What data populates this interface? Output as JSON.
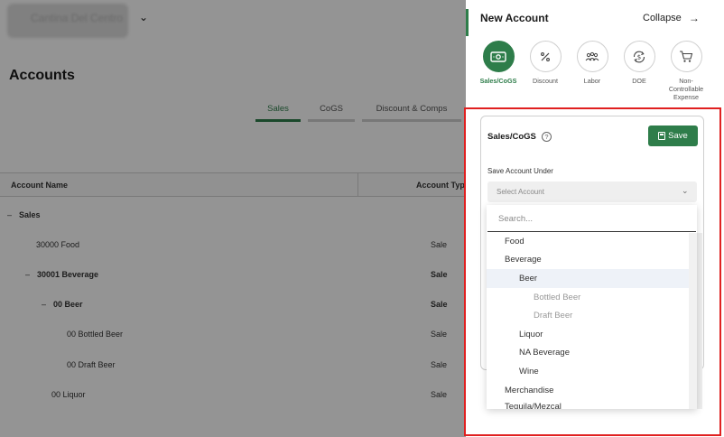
{
  "header": {
    "restaurant_name": "Cantina Del Centro"
  },
  "page": {
    "title": "Accounts"
  },
  "tabs": [
    {
      "label": "Sales",
      "active": true
    },
    {
      "label": "CoGS",
      "active": false
    },
    {
      "label": "Discount & Comps",
      "active": false
    }
  ],
  "table": {
    "columns": [
      "Account Name",
      "Account Type"
    ],
    "rows": [
      {
        "name": "Sales",
        "type": "",
        "bold": true,
        "prefix": "–"
      },
      {
        "name": "30000 Food",
        "type": "Sale",
        "bold": false,
        "prefix": ""
      },
      {
        "name": "30001 Beverage",
        "type": "Sale",
        "bold": true,
        "prefix": "–"
      },
      {
        "name": "00 Beer",
        "type": "Sale",
        "bold": true,
        "prefix": "–"
      },
      {
        "name": "00 Bottled Beer",
        "type": "Sale",
        "bold": false,
        "prefix": ""
      },
      {
        "name": "00 Draft Beer",
        "type": "Sale",
        "bold": false,
        "prefix": ""
      },
      {
        "name": "00 Liquor",
        "type": "Sale",
        "bold": false,
        "prefix": ""
      }
    ]
  },
  "panel": {
    "title": "New Account",
    "collapse_label": "Collapse",
    "account_types": [
      {
        "label": "Sales/CoGS",
        "icon": "cash-icon",
        "active": true
      },
      {
        "label": "Discount",
        "icon": "percent-icon",
        "active": false
      },
      {
        "label": "Labor",
        "icon": "labor-icon",
        "active": false
      },
      {
        "label": "DOE",
        "icon": "dollar-cycle-icon",
        "active": false
      },
      {
        "label": "Non-Controllable Expense",
        "icon": "cart-icon",
        "active": false
      }
    ],
    "form": {
      "title": "Sales/CoGS",
      "help_glyph": "?",
      "save_label": "Save",
      "field_label": "Save Account Under",
      "select_placeholder": "Select Account",
      "search_placeholder": "Search..."
    },
    "dropdown_items": [
      {
        "label": "Food",
        "level": 0,
        "selected": false
      },
      {
        "label": "Beverage",
        "level": 0,
        "selected": false
      },
      {
        "label": "Beer",
        "level": 1,
        "selected": true
      },
      {
        "label": "Bottled Beer",
        "level": 2,
        "selected": false
      },
      {
        "label": "Draft Beer",
        "level": 2,
        "selected": false
      },
      {
        "label": "Liquor",
        "level": 1,
        "selected": false
      },
      {
        "label": "NA Beverage",
        "level": 1,
        "selected": false
      },
      {
        "label": "Wine",
        "level": 1,
        "selected": false
      },
      {
        "label": "Merchandise",
        "level": 0,
        "selected": false
      },
      {
        "label": "Tequila/Mezcal",
        "level": 0,
        "selected": false
      }
    ]
  },
  "colors": {
    "accent": "#2e7d4a",
    "highlight": "#e02020"
  }
}
